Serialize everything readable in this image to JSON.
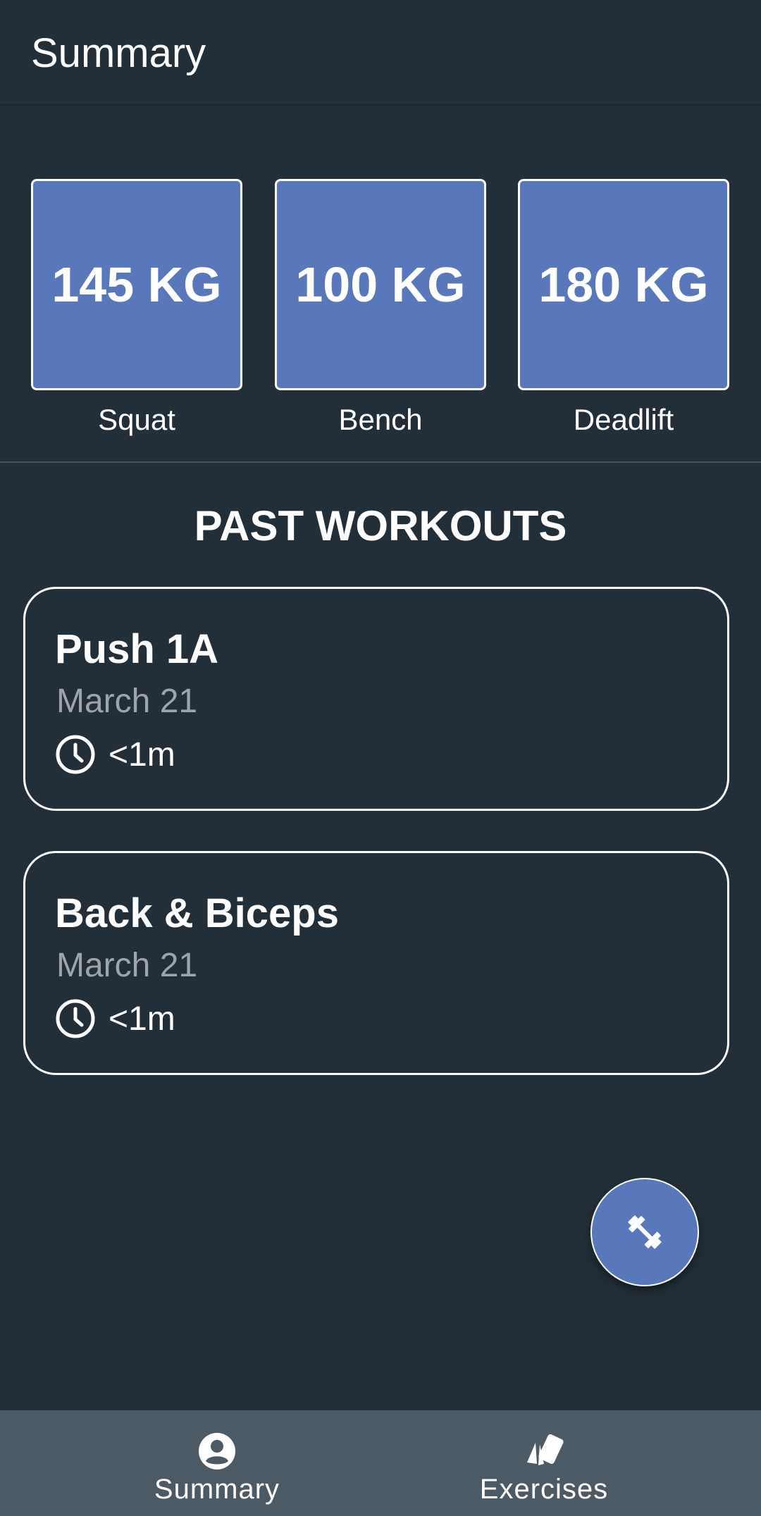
{
  "header": {
    "title": "Summary"
  },
  "lifts": [
    {
      "value": "145 KG",
      "label": "Squat"
    },
    {
      "value": "100 KG",
      "label": "Bench"
    },
    {
      "value": "180 KG",
      "label": "Deadlift"
    }
  ],
  "past_workouts": {
    "title": "PAST WORKOUTS",
    "items": [
      {
        "name": "Push 1A",
        "date": "March 21",
        "duration": "<1m",
        "icon": "clock-icon"
      },
      {
        "name": "Back & Biceps",
        "date": "March 21",
        "duration": "<1m",
        "icon": "clock-icon"
      }
    ]
  },
  "fab": {
    "icon": "dumbbell-icon"
  },
  "bottom_nav": {
    "items": [
      {
        "label": "Summary",
        "icon": "account-circle-icon"
      },
      {
        "label": "Exercises",
        "icon": "cards-icon"
      }
    ]
  },
  "colors": {
    "background": "#232f38",
    "accent": "#5878bb",
    "nav_background": "#4b5a64",
    "muted_text": "#9ea4a9"
  }
}
